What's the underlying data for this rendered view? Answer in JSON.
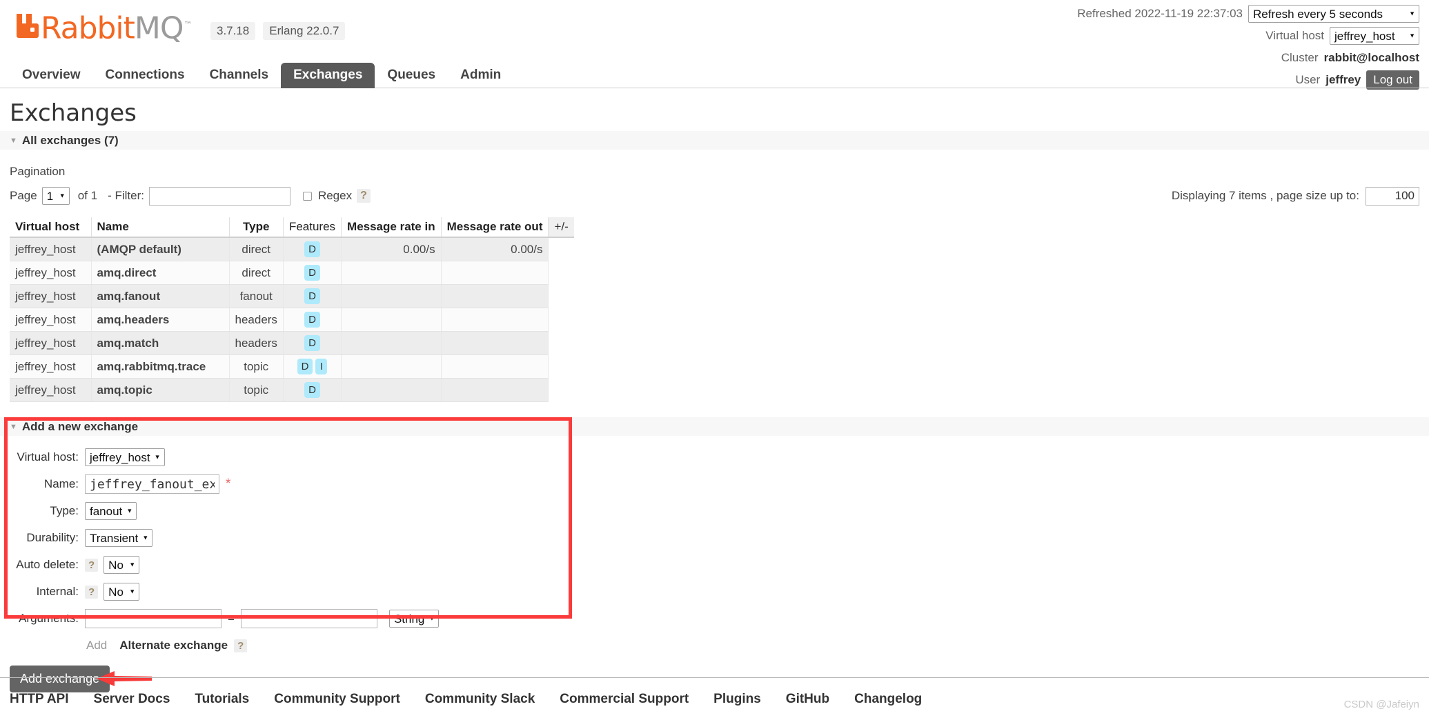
{
  "brand": {
    "name_part1": "Rabbit",
    "name_part2": "MQ",
    "trademark": "™",
    "version": "3.7.18",
    "erlang": "Erlang 22.0.7",
    "orange": "#F26722",
    "gray": "#9B9B9B"
  },
  "header": {
    "refreshed_label": "Refreshed 2022-11-19 22:37:03",
    "refresh_interval": "Refresh every 5 seconds",
    "vhost_label": "Virtual host",
    "vhost_value": "jeffrey_host",
    "cluster_label": "Cluster",
    "cluster_value": "rabbit@localhost",
    "user_label": "User",
    "user_value": "jeffrey",
    "logout_label": "Log out"
  },
  "nav": {
    "tabs": [
      {
        "label": "Overview",
        "active": false
      },
      {
        "label": "Connections",
        "active": false
      },
      {
        "label": "Channels",
        "active": false
      },
      {
        "label": "Exchanges",
        "active": true
      },
      {
        "label": "Queues",
        "active": false
      },
      {
        "label": "Admin",
        "active": false
      }
    ]
  },
  "main": {
    "page_title": "Exchanges",
    "all_exchanges_label": "All exchanges (7)",
    "pagination_label": "Pagination"
  },
  "pagination": {
    "page_label": "Page",
    "page_value": "1",
    "of_label": "of 1",
    "filter_label": "- Filter:",
    "filter_value": "",
    "regex_label": "Regex",
    "help_glyph": "?",
    "displaying_text": "Displaying 7 items , page size up to:",
    "page_size": "100"
  },
  "table": {
    "columns": [
      "Virtual host",
      "Name",
      "Type",
      "Features",
      "Message rate in",
      "Message rate out",
      "+/-"
    ],
    "rows": [
      {
        "vhost": "jeffrey_host",
        "name": "(AMQP default)",
        "type": "direct",
        "features": [
          "D"
        ],
        "rate_in": "0.00/s",
        "rate_out": "0.00/s"
      },
      {
        "vhost": "jeffrey_host",
        "name": "amq.direct",
        "type": "direct",
        "features": [
          "D"
        ],
        "rate_in": "",
        "rate_out": ""
      },
      {
        "vhost": "jeffrey_host",
        "name": "amq.fanout",
        "type": "fanout",
        "features": [
          "D"
        ],
        "rate_in": "",
        "rate_out": ""
      },
      {
        "vhost": "jeffrey_host",
        "name": "amq.headers",
        "type": "headers",
        "features": [
          "D"
        ],
        "rate_in": "",
        "rate_out": ""
      },
      {
        "vhost": "jeffrey_host",
        "name": "amq.match",
        "type": "headers",
        "features": [
          "D"
        ],
        "rate_in": "",
        "rate_out": ""
      },
      {
        "vhost": "jeffrey_host",
        "name": "amq.rabbitmq.trace",
        "type": "topic",
        "features": [
          "D",
          "I"
        ],
        "rate_in": "",
        "rate_out": ""
      },
      {
        "vhost": "jeffrey_host",
        "name": "amq.topic",
        "type": "topic",
        "features": [
          "D"
        ],
        "rate_in": "",
        "rate_out": ""
      }
    ]
  },
  "add_form": {
    "section_title": "Add a new exchange",
    "vhost_label": "Virtual host:",
    "vhost_value": "jeffrey_host",
    "name_label": "Name:",
    "name_value": "jeffrey_fanout_exchange",
    "required_marker": "*",
    "type_label": "Type:",
    "type_value": "fanout",
    "durability_label": "Durability:",
    "durability_value": "Transient",
    "autodelete_label": "Auto delete:",
    "autodelete_value": "No",
    "internal_label": "Internal:",
    "internal_value": "No",
    "arguments_label": "Arguments:",
    "arg_key": "",
    "arg_value": "",
    "arg_type": "String",
    "equals": "=",
    "add_link": "Add",
    "alternate_exchange": "Alternate exchange",
    "help_glyph": "?",
    "submit_label": "Add exchange",
    "highlight_color": "#FB3B3B"
  },
  "footer": {
    "links": [
      "HTTP API",
      "Server Docs",
      "Tutorials",
      "Community Support",
      "Community Slack",
      "Commercial Support",
      "Plugins",
      "GitHub",
      "Changelog"
    ],
    "watermark": "CSDN @Jafeiyn"
  }
}
